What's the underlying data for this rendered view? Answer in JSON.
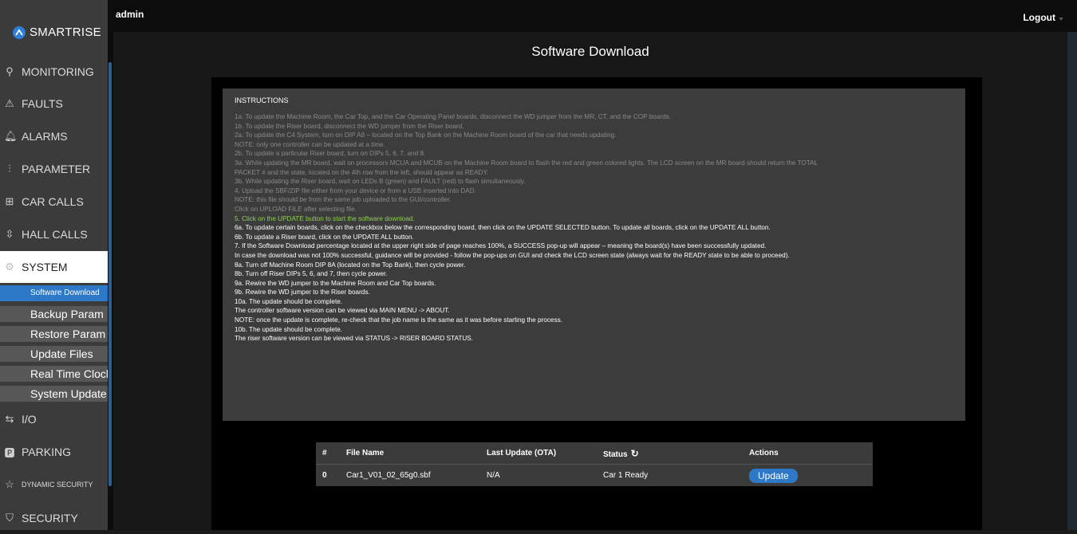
{
  "header": {
    "user": "admin",
    "logout": "Logout"
  },
  "brand": {
    "name": "SMARTRISE"
  },
  "sidebar": {
    "items": [
      {
        "label": "MONITORING",
        "icon": "search-icon"
      },
      {
        "label": "FAULTS",
        "icon": "warning-icon"
      },
      {
        "label": "ALARMS",
        "icon": "bell-icon"
      },
      {
        "label": "PARAMETER",
        "icon": "sliders-icon"
      },
      {
        "label": "CAR CALLS",
        "icon": "keypad-icon"
      },
      {
        "label": "HALL CALLS",
        "icon": "up-down-icon"
      },
      {
        "label": "SYSTEM",
        "icon": "gear-icon"
      },
      {
        "label": "I/O",
        "icon": "swap-icon"
      },
      {
        "label": "PARKING",
        "icon": "parking-icon"
      },
      {
        "label": "DYNAMIC SECURITY",
        "icon": "star-icon"
      },
      {
        "label": "SECURITY",
        "icon": "shield-icon"
      }
    ],
    "subitems": [
      "Software Download",
      "Backup Param",
      "Restore Param",
      "Update Files",
      "Real Time Clock",
      "System Update"
    ]
  },
  "main": {
    "title": "Software Download",
    "instructions_heading": "INSTRUCTIONS",
    "instructions": [
      {
        "text": "1a. To update the Machine Room, the Car Top, and the Car Operating Panel boards, disconnect the WD jumper from the MR, CT, and the COP boards.",
        "style": "gray"
      },
      {
        "text": "1b. To update the Riser board, disconnect the WD jumper from the Riser board.",
        "style": "gray"
      },
      {
        "text": "2a. To update the C4 System, turn on DIP A8 – located on the Top Bank on the Machine Room board of the car that needs updating.",
        "style": "gray"
      },
      {
        "text": "NOTE: only one controller can be updated at a time.",
        "style": "gray"
      },
      {
        "text": "2b. To update a particular Riser board, turn on DIPs 5, 6, 7, and 8.",
        "style": "gray"
      },
      {
        "text": "3a. While updating the MR board, wait on processors MCUA and MCUB on the Machine Room board to flash the red and green colored lights. The LCD screen on the MR board should return the TOTAL",
        "style": "gray"
      },
      {
        "text": "PACKET # and the state, located on the 4th row from the left, should appear as READY.",
        "style": "gray"
      },
      {
        "text": "3b. While updating the Riser board, wait on LEDs B (green) and FAULT (red) to flash simultaneously.",
        "style": "gray"
      },
      {
        "text": "4. Upload the SBF/ZIP file either from your device or from a USB inserted into DAD.",
        "style": "gray"
      },
      {
        "text": "NOTE: this file should be from the same job uploaded to the GUI/controller.",
        "style": "gray"
      },
      {
        "text": "Click on UPLOAD FILE after selecting file.",
        "style": "gray"
      },
      {
        "text": "5. Click on the UPDATE button to start the software download.",
        "style": "green"
      },
      {
        "text": "6a. To update certain boards, click on the checkbox below the corresponding board, then click on the UPDATE SELECTED button. To update all boards, click on the UPDATE ALL button.",
        "style": "white"
      },
      {
        "text": "6b. To update a Riser board, click on the UPDATE ALL button.",
        "style": "white"
      },
      {
        "text": "7. If the Software Download percentage located at the upper right side of page reaches 100%, a SUCCESS pop-up will appear – meaning the board(s) have been successfully updated.",
        "style": "white"
      },
      {
        "text": "In case the download was not 100% successful, guidance will be provided - follow the pop-ups on GUI and check the LCD screen state (always wait for the READY state to be able to proceed).",
        "style": "white"
      },
      {
        "text": "8a. Turn off Machine Room DIP 8A (located on the Top Bank), then cycle power.",
        "style": "white"
      },
      {
        "text": "8b. Turn off Riser DIPs 5, 6, and 7, then cycle power.",
        "style": "white"
      },
      {
        "text": "9a. Rewire the WD jumper to the Machine Room and Car Top boards.",
        "style": "white"
      },
      {
        "text": "9b. Rewire the WD jumper to the Riser boards.",
        "style": "white"
      },
      {
        "text": "10a. The update should be complete.",
        "style": "white"
      },
      {
        "text": "The controller software version can be viewed via MAIN MENU -> ABOUT.",
        "style": "white"
      },
      {
        "text": "NOTE: once the update is complete, re-check that the job name is the same as it was before starting the process.",
        "style": "white"
      },
      {
        "text": "10b. The update should be complete.",
        "style": "white"
      },
      {
        "text": "The riser software version can be viewed via STATUS -> RISER BOARD STATUS.",
        "style": "white"
      }
    ],
    "table": {
      "headers": [
        "#",
        "File Name",
        "Last Update (OTA)",
        "Status",
        "Actions"
      ],
      "rows": [
        {
          "index": "0",
          "file": "Car1_V01_02_65g0.sbf",
          "last_update": "N/A",
          "status": "Car 1 Ready",
          "action": "Update"
        }
      ]
    }
  }
}
